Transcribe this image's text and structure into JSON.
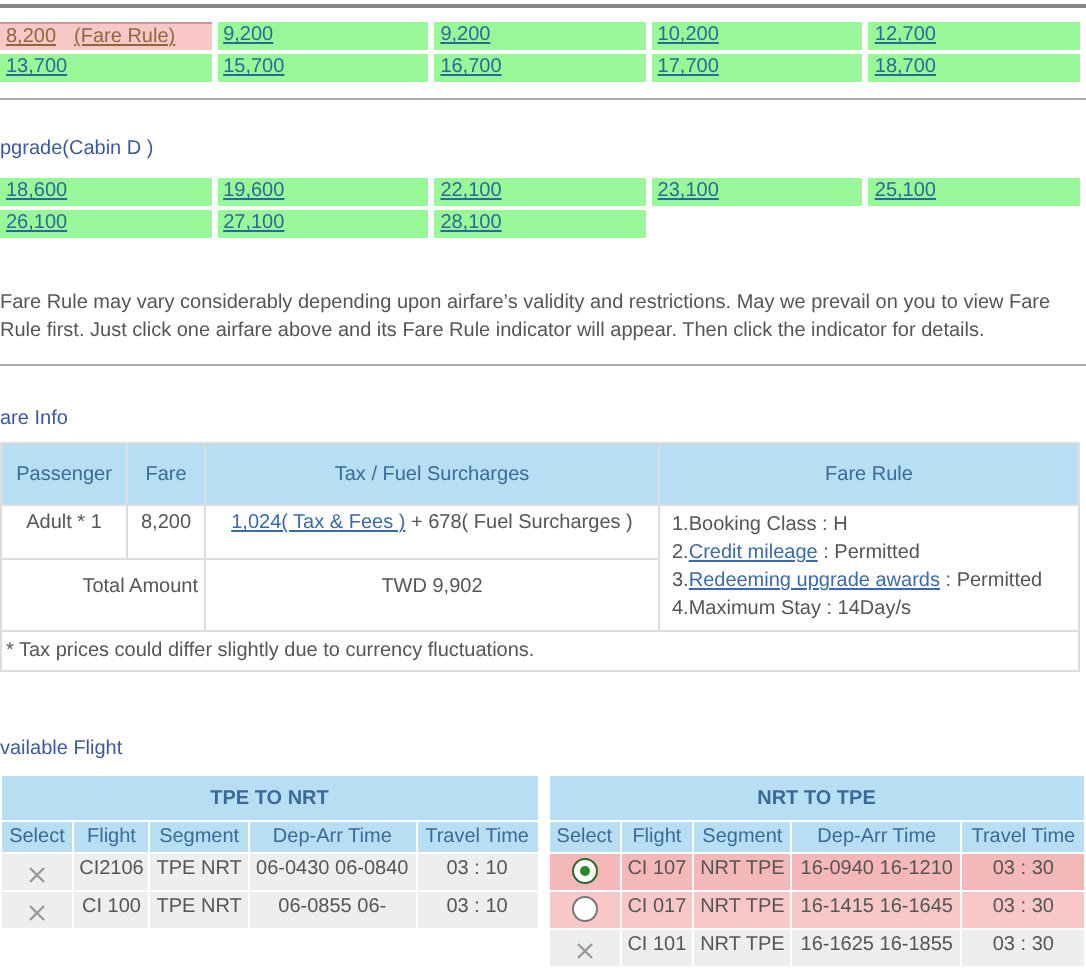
{
  "fare_options": {
    "rows": [
      [
        {
          "price": "8,200",
          "fare_rule": "(Fare Rule)",
          "selected": true
        },
        {
          "price": "9,200",
          "selected": false
        },
        {
          "price": "9,200",
          "selected": false
        },
        {
          "price": "10,200",
          "selected": false
        },
        {
          "price": "12,700",
          "selected": false
        }
      ],
      [
        {
          "price": "13,700",
          "selected": false
        },
        {
          "price": "15,700",
          "selected": false
        },
        {
          "price": "16,700",
          "selected": false
        },
        {
          "price": "17,700",
          "selected": false
        },
        {
          "price": "18,700",
          "selected": false
        }
      ]
    ]
  },
  "upgrade": {
    "title": "pgrade(Cabin D )",
    "rows": [
      [
        {
          "price": "18,600",
          "selected": false
        },
        {
          "price": "19,600",
          "selected": false
        },
        {
          "price": "22,100",
          "selected": false
        },
        {
          "price": "23,100",
          "selected": false
        },
        {
          "price": "25,100",
          "selected": false
        }
      ],
      [
        {
          "price": "26,100",
          "selected": false
        },
        {
          "price": "27,100",
          "selected": false
        },
        {
          "price": "28,100",
          "selected": false
        }
      ]
    ]
  },
  "notice": "Fare Rule may vary considerably depending upon airfare’s validity and restrictions. May we prevail on you to view Fare Rule first. Just click one airfare above and its Fare Rule indicator will appear. Then click the indicator for details.",
  "fare_info": {
    "title": "are Info",
    "columns": [
      "Passenger",
      "Fare",
      "Tax / Fuel Surcharges",
      "Fare Rule"
    ],
    "passenger": "Adult * 1",
    "fare": "8,200",
    "tax_link": "1,024( Tax & Fees )",
    "tax_rest": " + 678( Fuel Surcharges )",
    "rules": [
      {
        "num": "1.",
        "text": "Booking Class : H"
      },
      {
        "num": "2.",
        "link": "Credit mileage",
        "text": " : Permitted"
      },
      {
        "num": "3.",
        "link": "Redeeming upgrade awards",
        "text": " : Permitted"
      },
      {
        "num": "4.",
        "text": "Maximum Stay : 14Day/s"
      }
    ],
    "total_label": "Total Amount",
    "total": "TWD 9,902",
    "note": "* Tax prices could differ slightly due to currency fluctuations."
  },
  "available": {
    "title": "vailable Flight",
    "tables": [
      {
        "title": "TPE TO NRT",
        "columns": [
          "Select",
          "Flight",
          "Segment",
          "Dep-Arr Time",
          "Travel Time"
        ],
        "rows": [
          {
            "kind": "unavailable",
            "selected": false,
            "flight": "CI2106",
            "segment": "TPE NRT",
            "time": "06-0430 06-0840",
            "travel": "03 : 10"
          },
          {
            "kind": "unavailable",
            "selected": false,
            "flight": "CI 100",
            "segment": "TPE NRT",
            "time": "06-0855 06-",
            "travel": "03 : 10"
          }
        ]
      },
      {
        "title": "NRT TO TPE",
        "columns": [
          "Select",
          "Flight",
          "Segment",
          "Dep-Arr Time",
          "Travel Time"
        ],
        "rows": [
          {
            "kind": "radio",
            "selected": true,
            "flight": "CI 107",
            "segment": "NRT TPE",
            "time": "16-0940 16-1210",
            "travel": "03 : 30"
          },
          {
            "kind": "radio",
            "selected": false,
            "flight": "CI 017",
            "segment": "NRT TPE",
            "time": "16-1415 16-1645",
            "travel": "03 : 30"
          },
          {
            "kind": "unavailable",
            "selected": false,
            "flight": "CI 101",
            "segment": "NRT TPE",
            "time": "16-1625 16-1855",
            "travel": "03 : 30"
          }
        ]
      }
    ]
  }
}
